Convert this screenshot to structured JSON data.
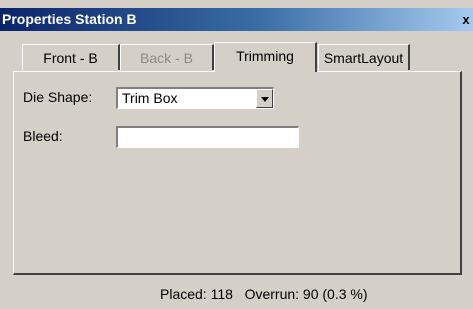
{
  "window": {
    "title": "Properties Station B",
    "close_glyph": "x"
  },
  "tabs": [
    {
      "label": "Front - B",
      "state": "normal"
    },
    {
      "label": "Back - B",
      "state": "disabled"
    },
    {
      "label": "Trimming",
      "state": "active"
    },
    {
      "label": "SmartLayout",
      "state": "normal"
    }
  ],
  "form": {
    "die_shape_label": "Die Shape:",
    "die_shape_value": "Trim Box",
    "bleed_label": "Bleed:",
    "bleed_value": ""
  },
  "status": {
    "placed": "Placed: 118",
    "overrun": "Overrun: 90 (0.3 %)"
  },
  "colors": {
    "face": "#d4d0c8",
    "title_start": "#0a246a",
    "title_end": "#a6caf0"
  }
}
